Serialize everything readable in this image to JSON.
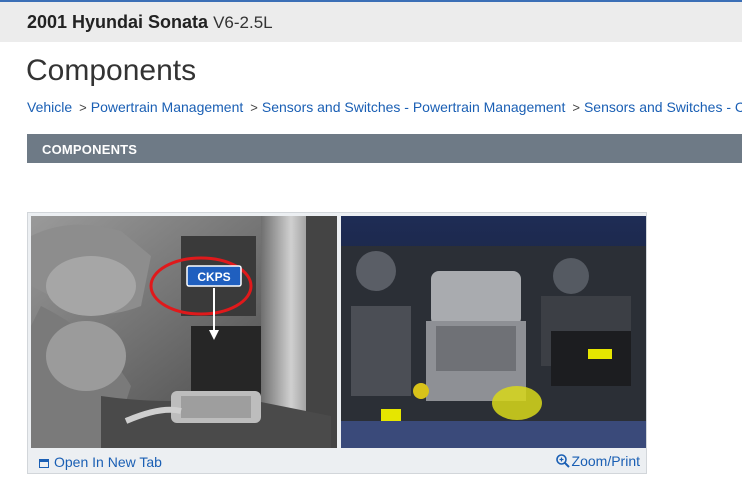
{
  "vehicle": {
    "name": "2001 Hyundai Sonata",
    "engine": "V6-2.5L"
  },
  "page": {
    "title": "Components"
  },
  "breadcrumb": {
    "items": [
      "Vehicle",
      "Powertrain Management",
      "Sensors and Switches - Powertrain Management",
      "Sensors and Switches - C"
    ]
  },
  "section": {
    "title": "COMPONENTS"
  },
  "figure": {
    "callout_label": "CKPS",
    "open_tab_label": "Open In New Tab",
    "zoom_label": "Zoom/Print",
    "icons": [
      "open-tab-icon",
      "zoom-icon"
    ]
  },
  "colors": {
    "link": "#1a5fb4",
    "section_bar": "#6e7a86",
    "callout_bg": "#1f5fbf",
    "callout_circle": "#e0191b",
    "highlight": "#e6e600"
  }
}
